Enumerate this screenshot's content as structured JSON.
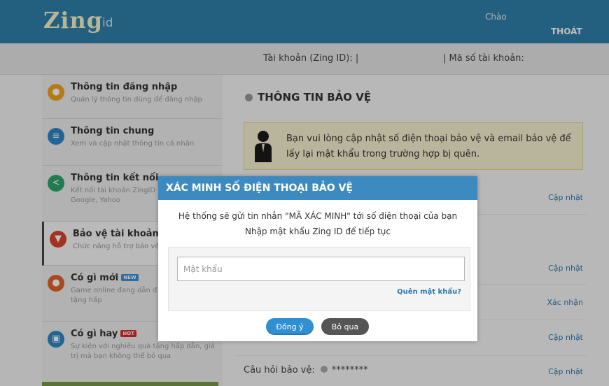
{
  "header": {
    "logo": "Zing",
    "logo_suffix": "id",
    "greeting": "Chào",
    "logout": "THOÁT"
  },
  "account_bar": {
    "zing_id_label": "Tài khoản (Zing ID): |",
    "account_no_label": "| Mã số tài khoản:"
  },
  "sidebar": {
    "items": [
      {
        "title": "Thông tin đăng nhập",
        "sub": "Quản lý thông tin dùng để đăng nhập",
        "icon": "user-icon",
        "color": "#f0a31c"
      },
      {
        "title": "Thông tin chung",
        "sub": "Xem và cập nhật thông tin cá nhân",
        "icon": "list-icon",
        "color": "#2e86c6"
      },
      {
        "title": "Thông tin kết nối",
        "sub": "Kết nối tài khoản ZingID Facebook, Google, Yahoo",
        "icon": "share-icon",
        "color": "#2da76c"
      },
      {
        "title": "Bảo vệ tài khoản",
        "sub": "Chức năng hỗ trợ bảo vệ",
        "icon": "shield-icon",
        "color": "#d9432c"
      },
      {
        "title": "Có gì mới",
        "sub": "Game online đang dẫn đ cùng nhiều quà tặng hấp",
        "icon": "gamepad-icon",
        "color": "#e0632a",
        "badge": "NEW",
        "badge_color": "#3a8fd4"
      },
      {
        "title": "Có gì hay",
        "sub": "Sự kiện với nghiều quà tặng hấp dẫn, giá trị mà bạn không thể bỏ qua",
        "icon": "calendar-icon",
        "color": "#2e86c6",
        "badge": "HOT",
        "badge_color": "#d9302c"
      }
    ]
  },
  "main": {
    "section_title": "THÔNG TIN BẢO VỆ",
    "notice": "Bạn vui lòng cập nhật số điện thoại bảo vệ và email bảo vệ để lấy lại mật khẩu trong trường hợp bị quên.",
    "links": [
      "Cập nhật",
      "Cập nhật",
      "Xác nhận",
      "Cập nhật",
      "Cập nhật"
    ],
    "security_question_label": "Câu hỏi bảo vệ:",
    "security_question_value": "********"
  },
  "modal": {
    "title": "XÁC MINH SỐ ĐIỆN THOẠI BẢO VỆ",
    "line1": "Hệ thống sẽ gửi tin nhắn \"MÃ XÁC MINH\" tới số điện thoại của bạn",
    "line2": "Nhập mật khẩu Zing ID để tiếp tục",
    "password_placeholder": "Mật khẩu",
    "password_value": "",
    "forgot_link": "Quên mật khẩu?",
    "ok_button": "Đồng ý",
    "skip_button": "Bỏ qua"
  }
}
